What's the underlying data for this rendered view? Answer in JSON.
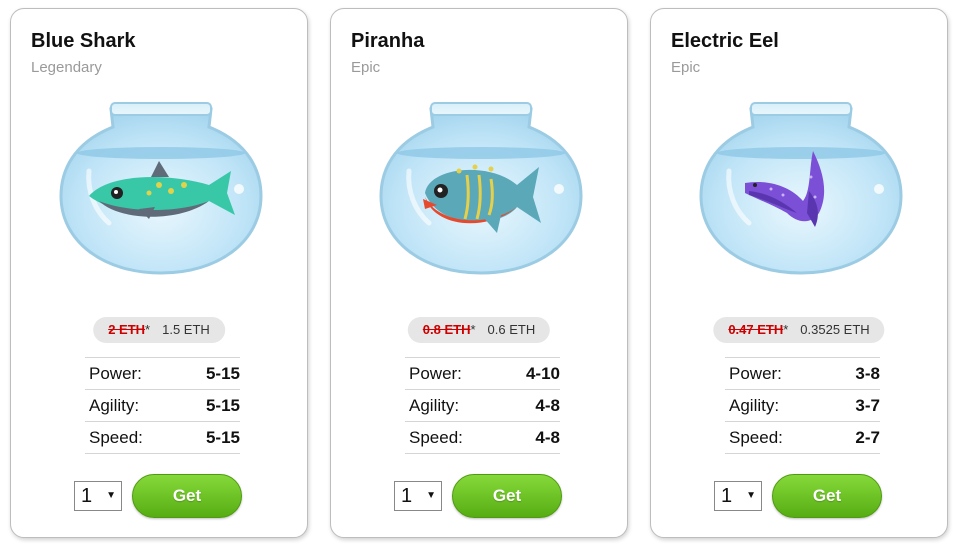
{
  "cards": [
    {
      "name": "Blue Shark",
      "rarity": "Legendary",
      "old_price": "2 ETH",
      "price_mark": "*",
      "price": "1.5 ETH",
      "stats": [
        {
          "label": "Power:",
          "value": "5-15"
        },
        {
          "label": "Agility:",
          "value": "5-15"
        },
        {
          "label": "Speed:",
          "value": "5-15"
        }
      ],
      "quantity": "1",
      "button": "Get"
    },
    {
      "name": "Piranha",
      "rarity": "Epic",
      "old_price": "0.8 ETH",
      "price_mark": "*",
      "price": "0.6 ETH",
      "stats": [
        {
          "label": "Power:",
          "value": "4-10"
        },
        {
          "label": "Agility:",
          "value": "4-8"
        },
        {
          "label": "Speed:",
          "value": "4-8"
        }
      ],
      "quantity": "1",
      "button": "Get"
    },
    {
      "name": "Electric Eel",
      "rarity": "Epic",
      "old_price": "0.47 ETH",
      "price_mark": "*",
      "price": "0.3525 ETH",
      "stats": [
        {
          "label": "Power:",
          "value": "3-8"
        },
        {
          "label": "Agility:",
          "value": "3-7"
        },
        {
          "label": "Speed:",
          "value": "2-7"
        }
      ],
      "quantity": "1",
      "button": "Get"
    }
  ],
  "colors": {
    "get_button": "#6cc425",
    "old_price": "#cc0000",
    "bowl_water": "#bfe4f7"
  }
}
